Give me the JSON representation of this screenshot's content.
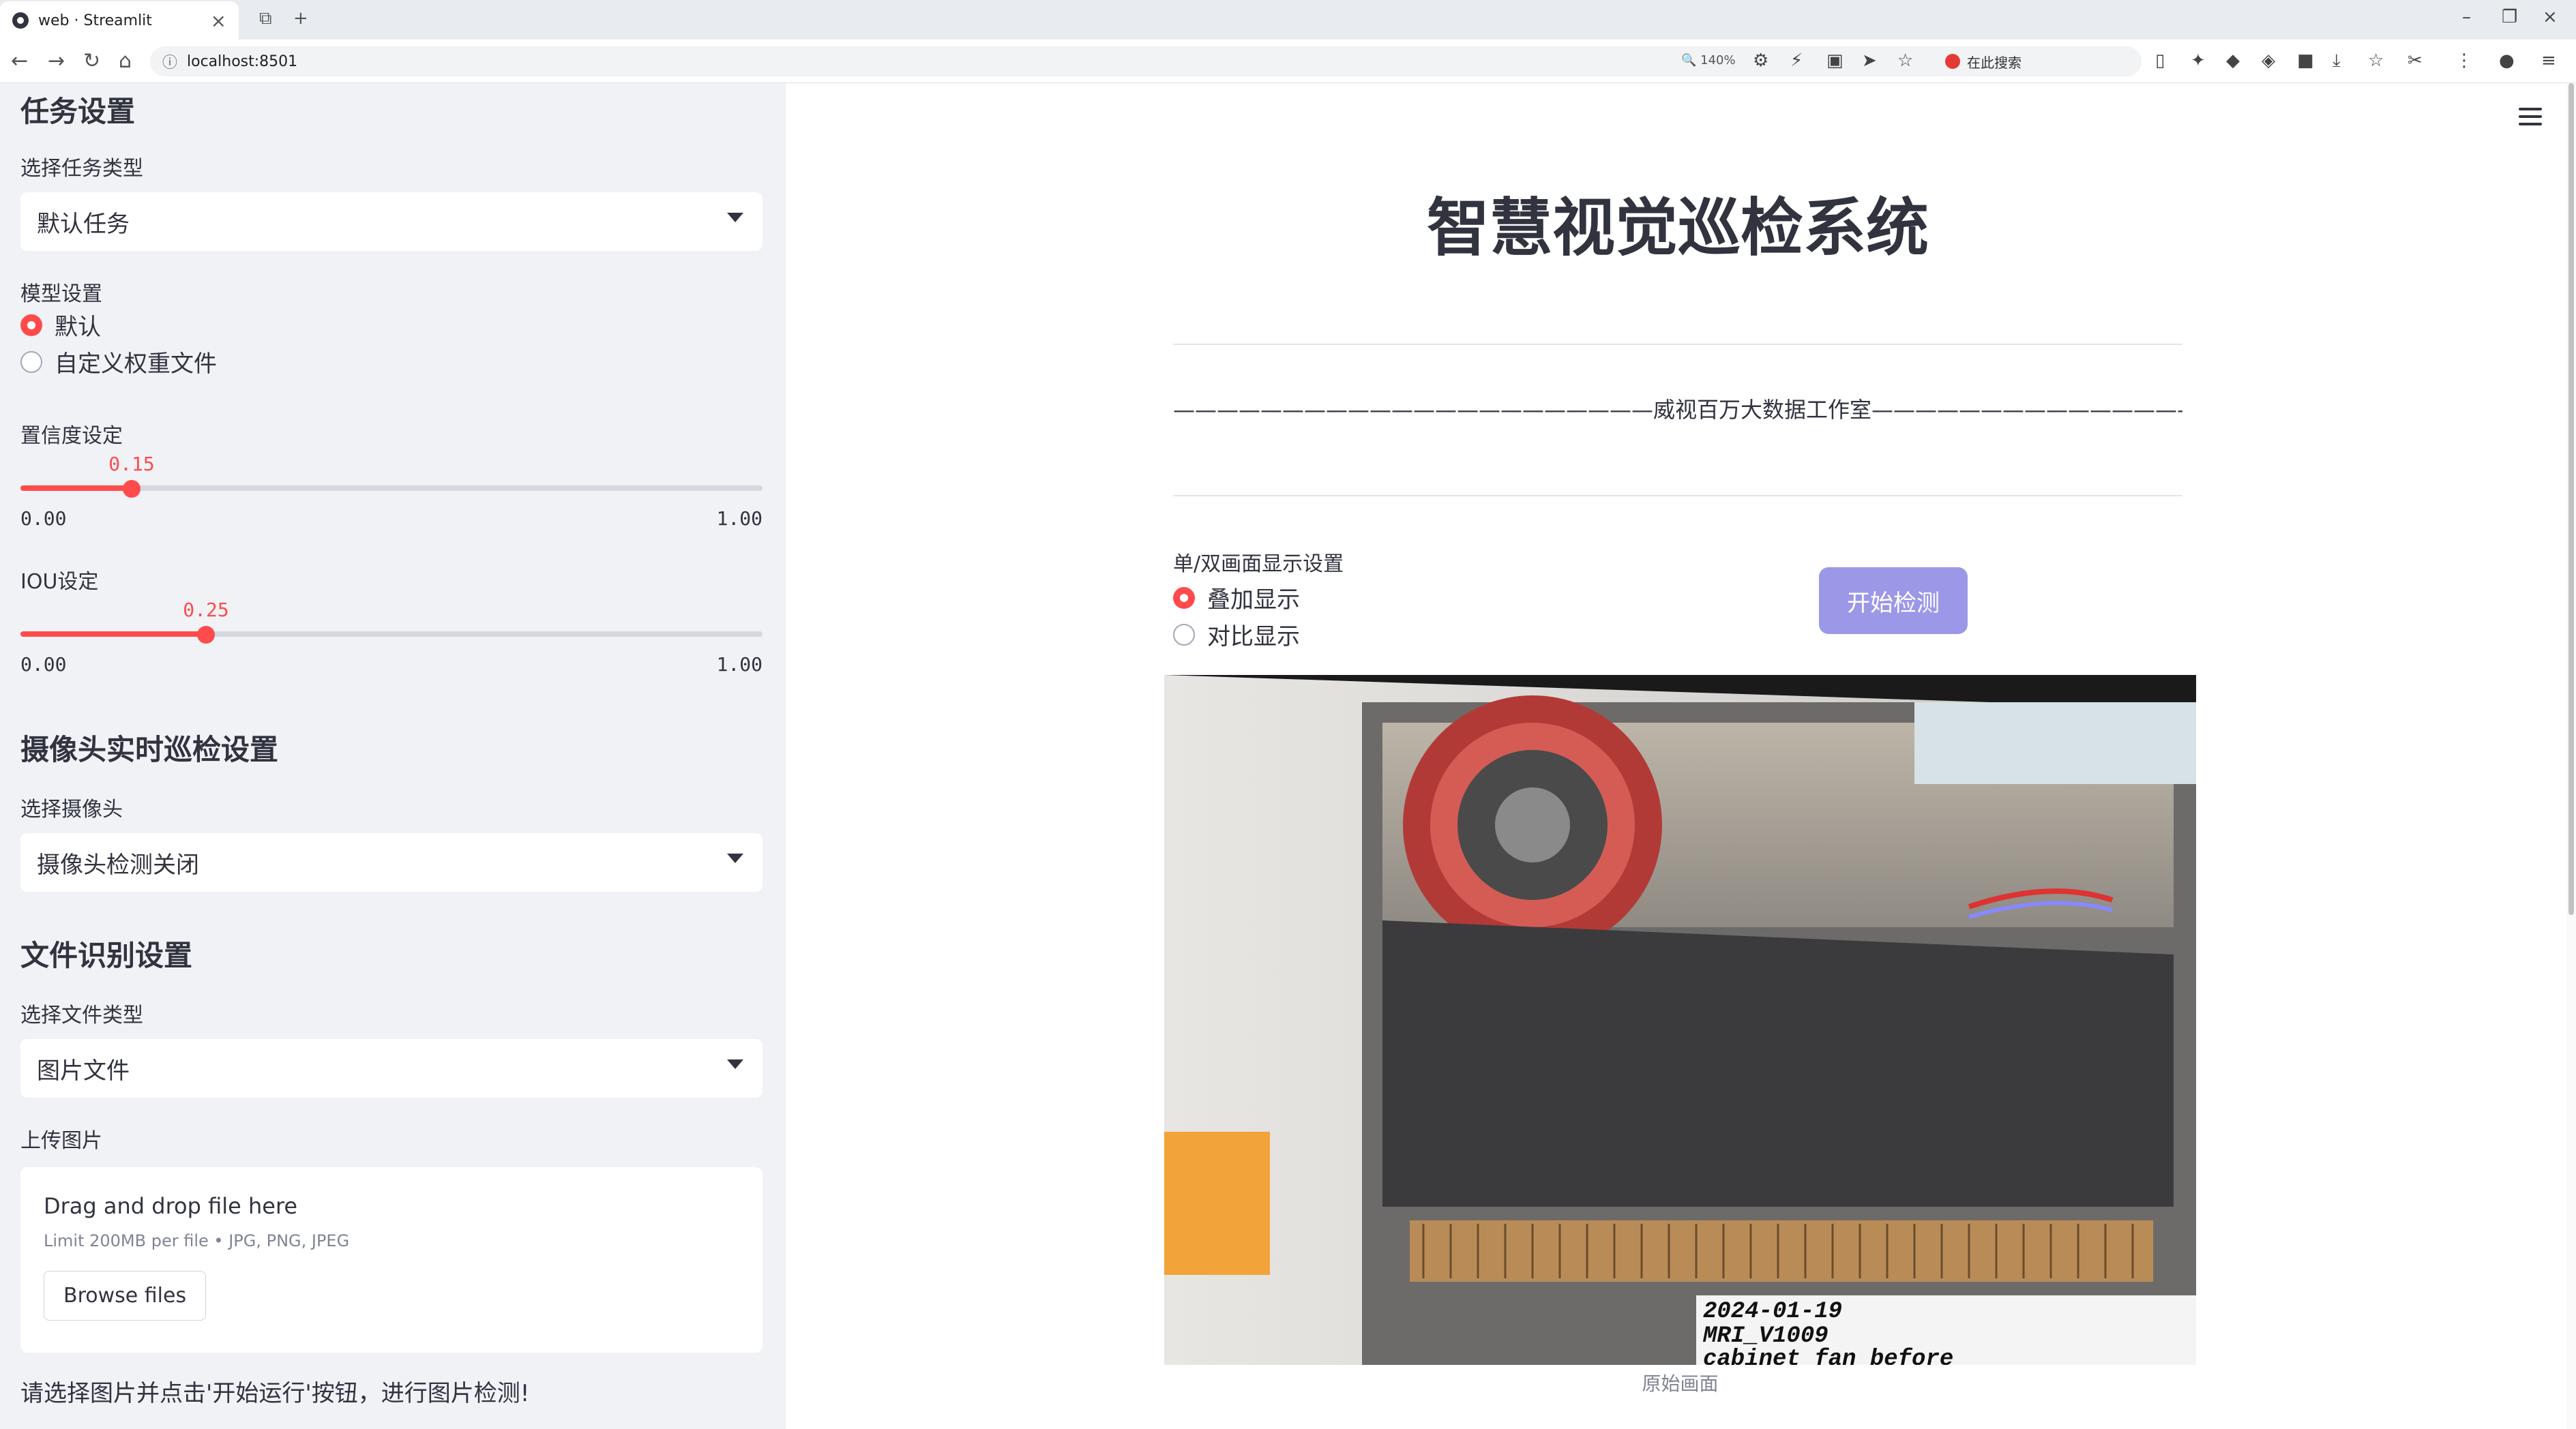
{
  "browser": {
    "tab_title": "web · Streamlit",
    "url": "localhost:8501",
    "zoom": "140%",
    "search_placeholder": "在此搜索"
  },
  "sidebar": {
    "task_section_title": "任务设置",
    "task_type_label": "选择任务类型",
    "task_type_value": "默认任务",
    "model_label": "模型设置",
    "model_options": [
      "默认",
      "自定义权重文件"
    ],
    "model_selected": "默认",
    "confidence_label": "置信度设定",
    "confidence_value": "0.15",
    "confidence_fraction": 0.15,
    "iou_label": "IOU设定",
    "iou_value": "0.25",
    "iou_fraction": 0.25,
    "slider_min": "0.00",
    "slider_max": "1.00",
    "camera_section_title": "摄像头实时巡检设置",
    "camera_label": "选择摄像头",
    "camera_value": "摄像头检测关闭",
    "file_section_title": "文件识别设置",
    "file_type_label": "选择文件类型",
    "file_type_value": "图片文件",
    "upload_label": "上传图片",
    "upload_title": "Drag and drop file here",
    "upload_limit": "Limit 200MB per file • JPG, PNG, JPEG",
    "browse_button": "Browse files",
    "hint": "请选择图片并点击'开始运行'按钮，进行图片检测!"
  },
  "main": {
    "title": "智慧视觉巡检系统",
    "subtitle": "——————————————————————威视百万大数据工作室———————————————————————",
    "display_label": "单/双画面显示设置",
    "display_options": [
      "叠加显示",
      "对比显示"
    ],
    "display_selected": "叠加显示",
    "start_button": "开始检测",
    "image_caption": "原始画面",
    "photo_text": [
      "2024-01-19",
      "MRI_V1009",
      "cabinet_fan_before"
    ]
  },
  "colors": {
    "accent": "#ff4b4b",
    "sidebar_bg": "#f0f2f6",
    "button_primary": "#9c98e8"
  }
}
